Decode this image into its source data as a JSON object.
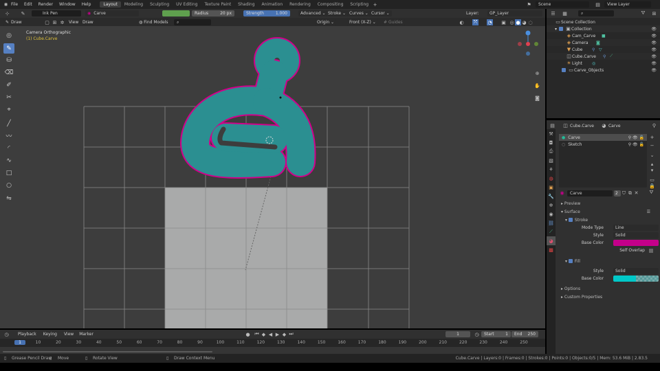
{
  "menu": [
    "File",
    "Edit",
    "Render",
    "Window",
    "Help"
  ],
  "workspaces": [
    "Layout",
    "Modeling",
    "Sculpting",
    "UV Editing",
    "Texture Paint",
    "Shading",
    "Animation",
    "Rendering",
    "Compositing",
    "Scripting"
  ],
  "scene": "Scene",
  "view_layer": "View Layer",
  "toolbar": {
    "brush": "Ink Pen",
    "material": "Carve",
    "radius_label": "Radius",
    "radius_value": "20 px",
    "strength_label": "Strength",
    "strength_value": "1.000",
    "advanced": "Advanced",
    "stroke": "Stroke",
    "curves": "Curves",
    "cursor": "Cursor",
    "layer_label": "Layer:",
    "layer": "GP_Layer",
    "brush_color": "#5fa04e"
  },
  "viewheader": {
    "mode": "Draw",
    "view": "View",
    "draw": "Draw",
    "find": "Find Models",
    "origin": "Origin",
    "front": "Front (X-Z)",
    "guides": "Guides"
  },
  "viewport": {
    "camera": "Camera Orthographic",
    "object": "(1) Cube.Carve"
  },
  "outliner": {
    "root": "Scene Collection",
    "items": [
      {
        "name": "Collection"
      },
      {
        "name": "Cam_Carve"
      },
      {
        "name": "Camera"
      },
      {
        "name": "Cube"
      },
      {
        "name": "Cube.Carve"
      },
      {
        "name": "Light"
      },
      {
        "name": "Carve_Objects"
      }
    ]
  },
  "properties": {
    "object": "Cube.Carve",
    "material": "Carve",
    "slots": [
      "Carve",
      "Sketch"
    ],
    "mat_name": "Carve",
    "users": "2",
    "panels": {
      "preview": "Preview",
      "surface": "Surface",
      "stroke": "Stroke",
      "fill": "Fill",
      "options": "Options",
      "custom": "Custom Properties"
    },
    "stroke_fields": {
      "mode_type_label": "Mode Type",
      "mode_type": "Line",
      "style_label": "Style",
      "style": "Solid",
      "base_color_label": "Base Color",
      "self_overlap_label": "Self Overlap"
    },
    "fill_fields": {
      "style_label": "Style",
      "style": "Solid",
      "base_color_label": "Base Color"
    },
    "stroke_color": "#c4008a",
    "fill_color": "#00c8c8"
  },
  "timeline": {
    "playback": "Playback",
    "keying": "Keying",
    "view": "View",
    "marker": "Marker",
    "current": "1",
    "start_label": "Start",
    "start": "1",
    "end_label": "End",
    "end": "250",
    "ticks": [
      "1",
      "10",
      "20",
      "30",
      "40",
      "50",
      "60",
      "70",
      "80",
      "90",
      "100",
      "110",
      "120",
      "130",
      "140",
      "150",
      "160",
      "170",
      "180",
      "190",
      "200",
      "210",
      "220",
      "230",
      "240",
      "250"
    ]
  },
  "status": {
    "left": "Grease Pencil Draw",
    "move": "Move",
    "rotate": "Rotate View",
    "context": "Draw Context Menu",
    "info": "Cube.Carve | Layers:0 | Frames:0 | Strokes:0 | Points:0 | Objects:0/5 | Mem: 53.6 MiB | 2.83.5"
  }
}
